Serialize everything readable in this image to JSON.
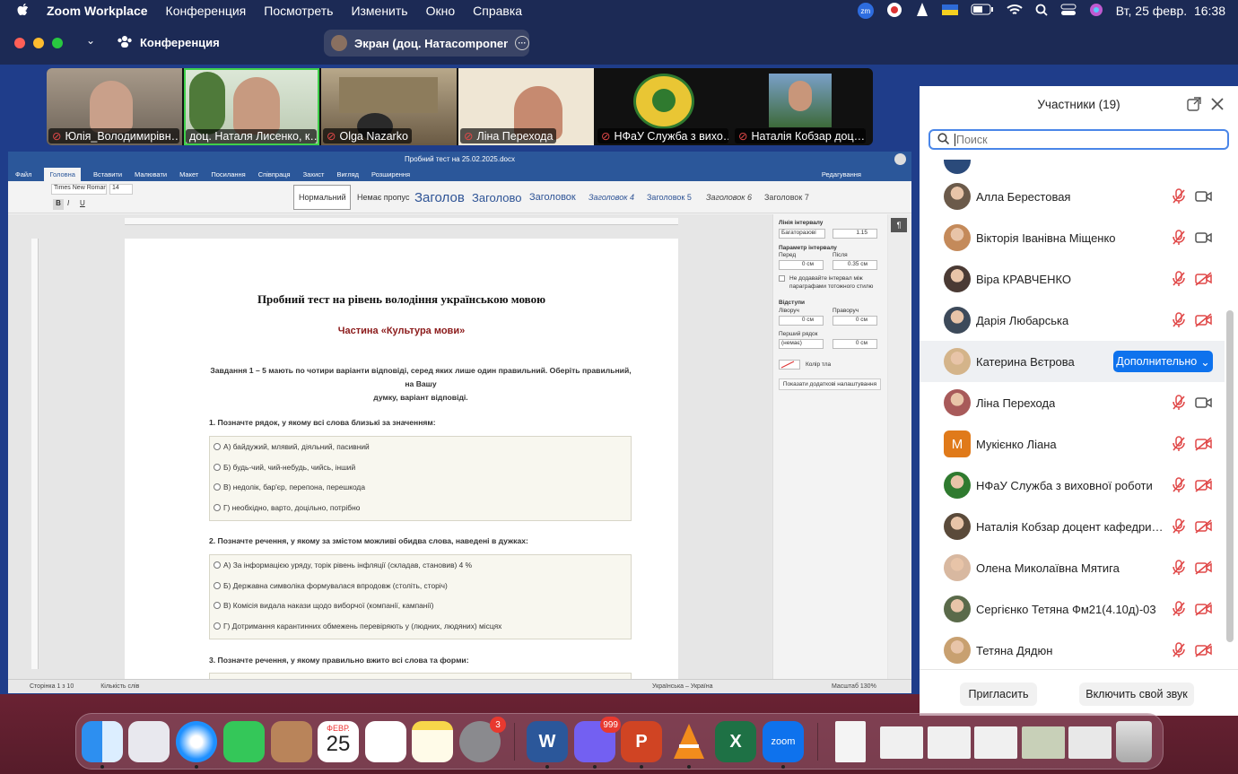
{
  "menubar": {
    "app_name": "Zoom Workplace",
    "items": [
      "Конференция",
      "Посмотреть",
      "Изменить",
      "Окно",
      "Справка"
    ],
    "clock": "Вт, 25 февр.  16:38",
    "zoom_badge": "zm"
  },
  "window": {
    "title": "Конференция",
    "screen_share_label": "Экран (доц. Натаcomponent Лисен…"
  },
  "videos": [
    {
      "name": "Юлія_Володимирівн…",
      "muted": true,
      "active": false
    },
    {
      "name": "доц. Наталя Лисенко, к…",
      "muted": false,
      "active": true
    },
    {
      "name": "Olga Nazarko",
      "muted": true,
      "active": false
    },
    {
      "name": "Ліна Перехода",
      "muted": true,
      "active": false
    },
    {
      "name": "НФаУ Служба з вихо…",
      "muted": true,
      "active": false
    },
    {
      "name": "Наталія Кобзар доц…",
      "muted": true,
      "active": false
    }
  ],
  "word": {
    "doc_title": "Пробний тест на 25.02.2025.docx",
    "tabs": [
      "Файл",
      "Головна",
      "Вставити",
      "Малювати",
      "Макет",
      "Посилання",
      "Співпраця",
      "Захист",
      "Вигляд",
      "Розширення"
    ],
    "edit_mode": "Редагування",
    "font_name": "Times New Roman",
    "font_size": "14",
    "styles": [
      "Нормальний",
      "Немає пропус",
      "Заголов",
      "Заголово",
      "Заголовок",
      "Заголовок 4",
      "Заголовок 5",
      "Заголовок 6",
      "Заголовок 7"
    ],
    "status_page": "Сторінка 1 з 10",
    "status_words": "Кількість слів",
    "status_lang": "Українська – Україна",
    "status_zoom": "Масштаб 130%",
    "pane": {
      "line_spacing_label": "Лінія інтервалу",
      "line_spacing_type": "Багаторазові",
      "line_spacing_value": "1.15",
      "para_spacing_label": "Параметр інтервалу",
      "before_label": "Перед",
      "after_label": "Після",
      "before_value": "0 см",
      "after_value": "0.35 см",
      "no_add_space": "Не додавайте інтервал між параграфами тотожного стилю",
      "indents_label": "Відступи",
      "left_label": "Ліворуч",
      "right_label": "Праворуч",
      "left_value": "0 см",
      "right_value": "0 см",
      "first_line_label": "Перший рядок",
      "first_line_type": "(немає)",
      "first_line_value": "0 см",
      "fill_color_label": "Колір тла",
      "more_settings": "Показати додаткові налаштування"
    },
    "page": {
      "title": "Пробний тест на рівень володіння українською мовою",
      "subtitle": "Частина «Культура мови»",
      "task_line1": "Завдання 1 – 5 мають по чотири варіанти відповіді, серед яких лише один правильний. Оберіть правильний, на Вашу",
      "task_line2": "думку, варіант відповіді.",
      "q1": "1. Позначте рядок, у якому всі слова близькі за значенням:",
      "q1_opts": [
        "А) байдужий, млявий, діяльний, пасивний",
        "Б) будь-чий, чий-небудь, чийсь, інший",
        "В) недолік, бар'єр, перепона, перешкода",
        "Г) необхідно, варто, доцільно, потрібно"
      ],
      "q2": "2. Позначте речення, у якому за змістом можливі обидва слова, наведені в дужках:",
      "q2_opts": [
        "А) За інформацією уряду, торік рівень інфляції (складав, становив) 4 %",
        "Б) Державна символіка формувалася впродовж (століть, сторіч)",
        "В) Комісія видала накази щодо виборчої (компанії, кампанії)",
        "Г) Дотримання карантинних обмежень перевіряють у (людних, людяних) місцях"
      ],
      "q3": "3. Позначте речення, у якому правильно вжито всі слова та форми:"
    }
  },
  "participants": {
    "header": "Участники (19)",
    "search_placeholder": "Поиск",
    "more_button": "Дополнительно",
    "invite_button": "Пригласить",
    "unmute_button": "Включить свой звук",
    "list": [
      {
        "name": "Алла Берестовая",
        "video_on": true,
        "avatar_color": "#6b5a4a",
        "initial": ""
      },
      {
        "name": "Вікторія Іванівна Міщенко",
        "video_on": true,
        "avatar_color": "#c48a5a",
        "initial": ""
      },
      {
        "name": "Віра КРАВЧЕНКО",
        "video_on": false,
        "avatar_color": "#4a3a34",
        "initial": ""
      },
      {
        "name": "Дарія Любарська",
        "video_on": false,
        "avatar_color": "#3d4a5a",
        "initial": ""
      },
      {
        "name": "Катерина Вєтрова",
        "video_on": false,
        "avatar_color": "#d4b48a",
        "initial": "",
        "highlighted": true
      },
      {
        "name": "Ліна Перехода",
        "video_on": true,
        "avatar_color": "#a85a5a",
        "initial": ""
      },
      {
        "name": "Мукієнко Ліана",
        "video_on": false,
        "avatar_color": "#e07a1a",
        "initial": "M"
      },
      {
        "name": "НФаУ Служба з виховної роботи",
        "video_on": false,
        "avatar_color": "#2f7a2f",
        "initial": ""
      },
      {
        "name": "Наталія Кобзар доцент кафедри…",
        "video_on": false,
        "avatar_color": "#5a4a3a",
        "initial": ""
      },
      {
        "name": "Олена Миколаївна Мятига",
        "video_on": false,
        "avatar_color": "#d8b8a0",
        "initial": ""
      },
      {
        "name": "Сергієнко Тетяна Фм21(4.10д)-03",
        "video_on": false,
        "avatar_color": "#5a6a4a",
        "initial": ""
      },
      {
        "name": "Тетяна Дядюн",
        "video_on": false,
        "avatar_color": "#c8a070",
        "initial": ""
      }
    ]
  },
  "dock": {
    "calendar_month": "ФЕВР.",
    "calendar_day": "25",
    "settings_badge": "3",
    "viber_badge": "999",
    "zoom_label": "zoom"
  },
  "colors": {
    "menubar": "#1c2a55",
    "zoom_blue": "#0e72ed",
    "word_blue": "#2b579a",
    "mute_red": "#e04848"
  }
}
